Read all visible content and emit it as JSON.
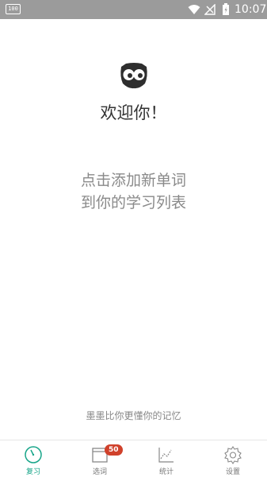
{
  "status_bar": {
    "left_icon_text": "100",
    "time": "10:07"
  },
  "main": {
    "welcome": "欢迎你！",
    "hint_line1": "点击添加新单词",
    "hint_line2": "到你的学习列表",
    "slogan": "墨墨比你更懂你的记忆"
  },
  "tabs": [
    {
      "label": "复习",
      "icon": "review-icon",
      "active": true
    },
    {
      "label": "选词",
      "icon": "select-words-icon",
      "badge": "50"
    },
    {
      "label": "统计",
      "icon": "statistics-icon"
    },
    {
      "label": "设置",
      "icon": "settings-icon"
    }
  ],
  "colors": {
    "accent": "#17a589",
    "badge": "#d0412b",
    "status_bar": "#9b9b9b"
  }
}
